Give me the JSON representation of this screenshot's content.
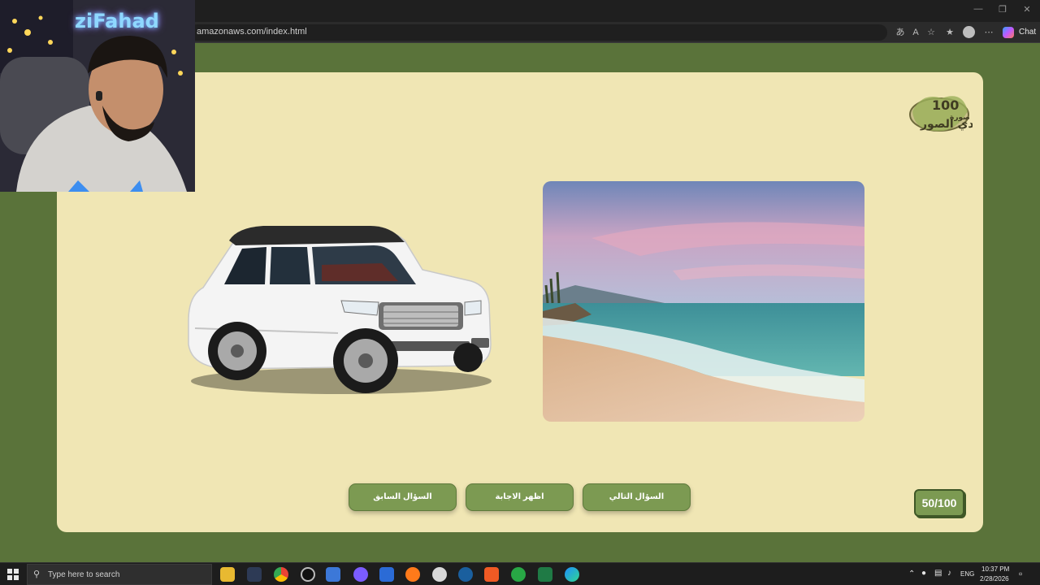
{
  "browser": {
    "url": "amazonaws.com/index.html",
    "chat_label": "Chat",
    "toolbar_icons": [
      "translate-icon",
      "read-aloud-icon",
      "favorite-star-icon",
      "favorites-icon",
      "profile-icon",
      "more-icon",
      "copilot-icon"
    ],
    "window_controls": [
      "minimize-icon",
      "restore-icon",
      "close-icon"
    ]
  },
  "stream": {
    "name": "ziFahad"
  },
  "game": {
    "logo_text_top": "100",
    "logo_text_mid": "صورة",
    "logo_text_bottom": "تحدي الصور",
    "buttons": {
      "previous": "السؤال السابق",
      "show_answer": "اظهر الاجابة",
      "next": "السؤال التالي"
    },
    "counter": "50/100",
    "colors": {
      "page_bg": "#5a733a",
      "card_bg": "#f0e6b4",
      "button_bg": "#7c9a52"
    }
  },
  "taskbar": {
    "search_placeholder": "Type here to search",
    "language": "ENG",
    "time": "10:37 PM",
    "date": "2/28/2026",
    "apps": [
      "file-explorer-icon",
      "app-icon",
      "chrome-icon",
      "obs-icon",
      "store-icon",
      "discord-icon",
      "word-icon",
      "firefox-icon",
      "app-icon",
      "steam-icon",
      "brave-icon",
      "xbox-icon",
      "excel-icon",
      "edge-icon"
    ]
  }
}
